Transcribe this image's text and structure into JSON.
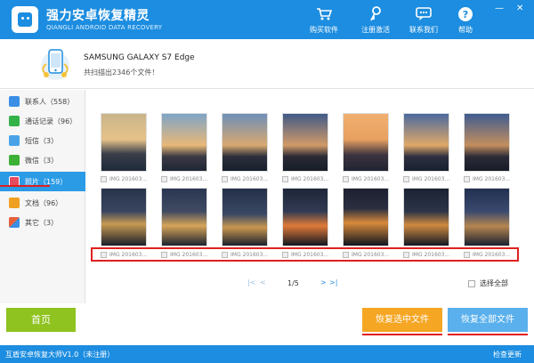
{
  "header": {
    "title": "强力安卓恢复精灵",
    "subtitle": "QIANGLI ANDROID DATA RECOVERY",
    "buttons": [
      {
        "label": "购买软件",
        "icon": "cart-icon"
      },
      {
        "label": "注册激活",
        "icon": "key-icon"
      },
      {
        "label": "联系我们",
        "icon": "chat-icon"
      },
      {
        "label": "帮助",
        "icon": "help-icon"
      }
    ],
    "window_controls": {
      "minimize": "—",
      "close": "✕"
    }
  },
  "device": {
    "name": "SAMSUNG  GALAXY S7 Edge",
    "scan_text": "共扫描出2346个文件！"
  },
  "sidebar": {
    "items": [
      {
        "label": "联系人（558）",
        "icon": "contacts-icon",
        "color": "#3a8ee6"
      },
      {
        "label": "通话记录（96）",
        "icon": "phone-icon",
        "color": "#34b24a"
      },
      {
        "label": "短信（3）",
        "icon": "sms-icon",
        "color": "#4aa3e8"
      },
      {
        "label": "微信（3）",
        "icon": "wechat-icon",
        "color": "#3cb034"
      },
      {
        "label": "照片（159）",
        "icon": "photo-icon",
        "color": "#e84a5f",
        "active": true
      },
      {
        "label": "文档（96）",
        "icon": "document-icon",
        "color": "#f0a020"
      },
      {
        "label": "其它（3）",
        "icon": "other-icon",
        "color": "#e8603a"
      }
    ]
  },
  "gallery": {
    "row1_captions": [
      "IMG 201603...",
      "IMG 201603...",
      "IMG 201603...",
      "IMG 201603...",
      "IMG 201603...",
      "IMG 201603...",
      "IMG 201603..."
    ],
    "row2_captions": [
      "IMG 201603...",
      "IMG 201603...",
      "IMG 201603...",
      "IMG 201603...",
      "IMG 201603...",
      "IMG 201603...",
      "IMG 201603..."
    ]
  },
  "pagination": {
    "page": "1/5",
    "first": "|<",
    "prev": "<",
    "next": ">",
    "last": ">|",
    "select_all": "选择全部"
  },
  "actions": {
    "home": "首页",
    "recover_selected": "恢复选中文件",
    "recover_all": "恢复全部文件"
  },
  "status": {
    "left": "互盾安卓恢复大师V1.0（未注册）",
    "right": "检查更新"
  },
  "colors": {
    "primary": "#1c8de0",
    "home": "#8fc31f",
    "recover_selected": "#f5a623",
    "recover_all": "#5ab0ec",
    "highlight": "#e02020"
  }
}
